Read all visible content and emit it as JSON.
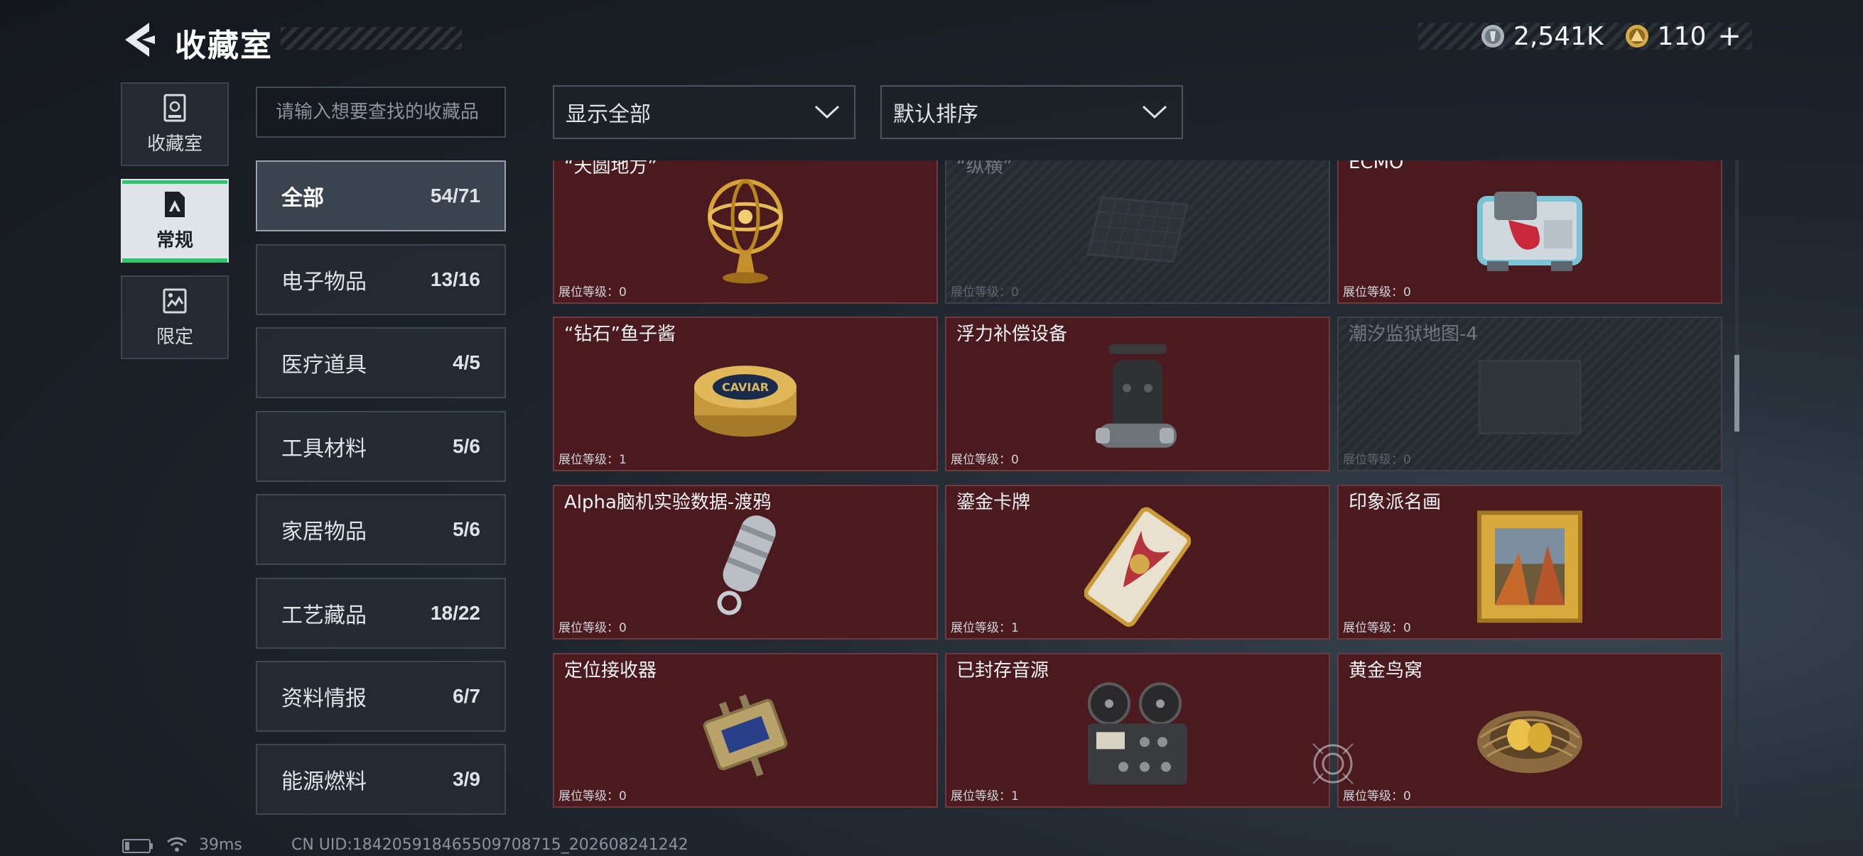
{
  "header": {
    "title": "收藏室",
    "currency": [
      {
        "icon": "silver-coin-icon",
        "amount": "2,541K"
      },
      {
        "icon": "gold-coin-icon",
        "amount": "110"
      }
    ],
    "currency_add": "+"
  },
  "side_tabs": [
    {
      "icon": "collection-room-icon",
      "label": "收藏室",
      "active": false
    },
    {
      "icon": "regular-icon",
      "label": "常规",
      "active": true
    },
    {
      "icon": "limited-icon",
      "label": "限定",
      "active": false
    }
  ],
  "search": {
    "placeholder": "请输入想要查找的收藏品"
  },
  "filters": {
    "show": "显示全部",
    "sort": "默认排序"
  },
  "categories": [
    {
      "name": "全部",
      "count": "54/71",
      "active": true
    },
    {
      "name": "电子物品",
      "count": "13/16"
    },
    {
      "name": "医疗道具",
      "count": "4/5"
    },
    {
      "name": "工具材料",
      "count": "5/6"
    },
    {
      "name": "家居物品",
      "count": "5/6"
    },
    {
      "name": "工艺藏品",
      "count": "18/22"
    },
    {
      "name": "资料情报",
      "count": "6/7"
    },
    {
      "name": "能源燃料",
      "count": "3/9"
    }
  ],
  "level_label": "展位等级：",
  "items": [
    {
      "name": "“天圆地方”",
      "level": "0",
      "locked": false,
      "icon": "armillary-sphere-icon"
    },
    {
      "name": "“纵横”",
      "level": "0",
      "locked": true,
      "icon": "chessboard-icon"
    },
    {
      "name": "ECMO",
      "level": "0",
      "locked": false,
      "icon": "ecmo-machine-icon"
    },
    {
      "name": "“钻石”鱼子酱",
      "level": "1",
      "locked": false,
      "icon": "caviar-tin-icon"
    },
    {
      "name": "浮力补偿设备",
      "level": "0",
      "locked": false,
      "icon": "buoyancy-device-icon"
    },
    {
      "name": "潮汐监狱地图-4",
      "level": "0",
      "locked": true,
      "icon": "map-icon"
    },
    {
      "name": "Alpha脑机实验数据-渡鸦",
      "level": "0",
      "locked": false,
      "icon": "data-capsule-icon"
    },
    {
      "name": "鎏金卡牌",
      "level": "1",
      "locked": false,
      "icon": "gilded-card-icon"
    },
    {
      "name": "印象派名画",
      "level": "0",
      "locked": false,
      "icon": "painting-icon"
    },
    {
      "name": "定位接收器",
      "level": "0",
      "locked": false,
      "icon": "locator-receiver-icon"
    },
    {
      "name": "已封存音源",
      "level": "1",
      "locked": false,
      "icon": "tape-recorder-icon"
    },
    {
      "name": "黄金鸟窝",
      "level": "0",
      "locked": false,
      "icon": "golden-nest-icon"
    }
  ],
  "footer": {
    "ping": "39ms",
    "uid": "CN UID:18420591846550970871​5_202608241242"
  },
  "accent_green": "#34c46e",
  "card_bg": "#4a1a1f"
}
